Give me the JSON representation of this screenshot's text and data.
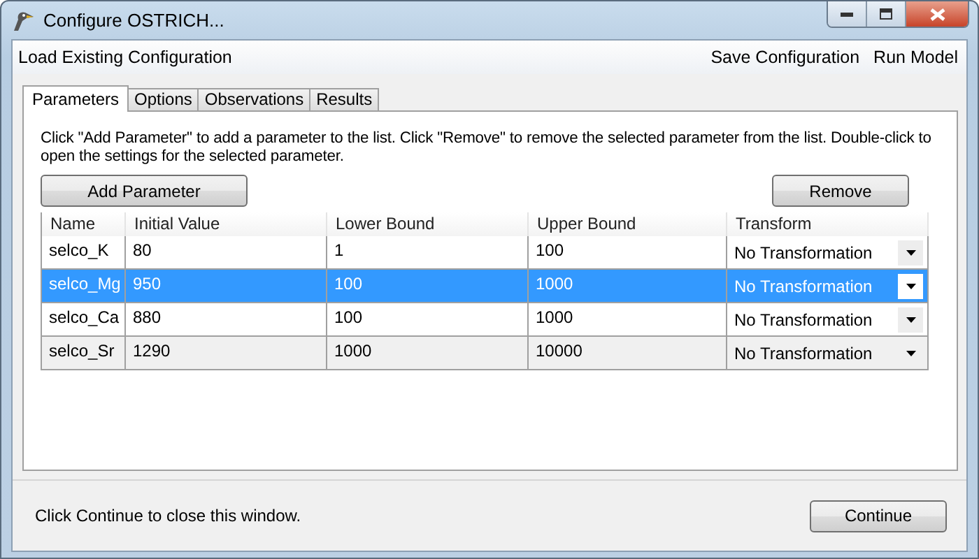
{
  "window": {
    "title": "Configure OSTRICH..."
  },
  "menu": {
    "left": [
      "Load Existing Configuration"
    ],
    "right": [
      "Save Configuration",
      "Run Model"
    ]
  },
  "tabs": [
    {
      "label": "Parameters",
      "selected": true
    },
    {
      "label": "Options",
      "selected": false
    },
    {
      "label": "Observations",
      "selected": false
    },
    {
      "label": "Results",
      "selected": false
    }
  ],
  "instructions": "Click \"Add Parameter\" to add a parameter to the list. Click \"Remove\" to remove the selected parameter from the list. Double-click to open the settings for the selected parameter.",
  "buttons": {
    "add": "Add Parameter",
    "remove": "Remove"
  },
  "table": {
    "columns": [
      "Name",
      "Initial Value",
      "Lower Bound",
      "Upper Bound",
      "Transform"
    ],
    "rows": [
      {
        "cells": [
          "selco_K",
          "80",
          "1",
          "100",
          "No Transformation"
        ],
        "selected": false,
        "shaded": false
      },
      {
        "cells": [
          "selco_Mg",
          "950",
          "100",
          "1000",
          "No Transformation"
        ],
        "selected": true,
        "shaded": false
      },
      {
        "cells": [
          "selco_Ca",
          "880",
          "100",
          "1000",
          "No Transformation"
        ],
        "selected": false,
        "shaded": false
      },
      {
        "cells": [
          "selco_Sr",
          "1290",
          "1000",
          "10000",
          "No Transformation"
        ],
        "selected": false,
        "shaded": true
      }
    ]
  },
  "status_bar": {
    "text": "Click Continue to close this window.",
    "button": "Continue"
  }
}
